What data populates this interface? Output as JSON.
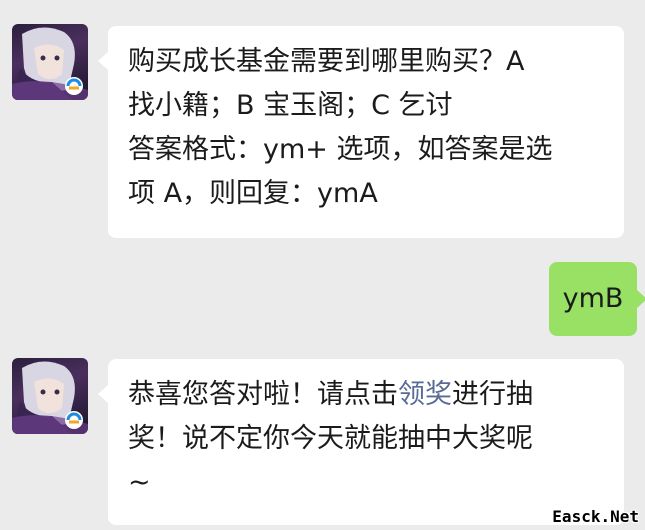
{
  "messages": [
    {
      "sender": "game-account",
      "lines": [
        "购买成长基金需要到哪里购买？A",
        "找小籍；B 宝玉阁；C 乞讨",
        "答案格式：ym+ 选项，如答案是选",
        "项 A，则回复：ymA"
      ]
    },
    {
      "sender": "me",
      "text": "ymB"
    },
    {
      "sender": "game-account",
      "parts": {
        "before": "恭喜您答对啦！请点击",
        "link": "领奖",
        "after": "进行抽",
        "line2": "奖！说不定你今天就能抽中大奖呢",
        "line3": "~"
      }
    }
  ],
  "watermark": "Easck.Net",
  "colors": {
    "link": "#576b95",
    "my_bubble": "#98e165",
    "background": "#ebebeb"
  }
}
